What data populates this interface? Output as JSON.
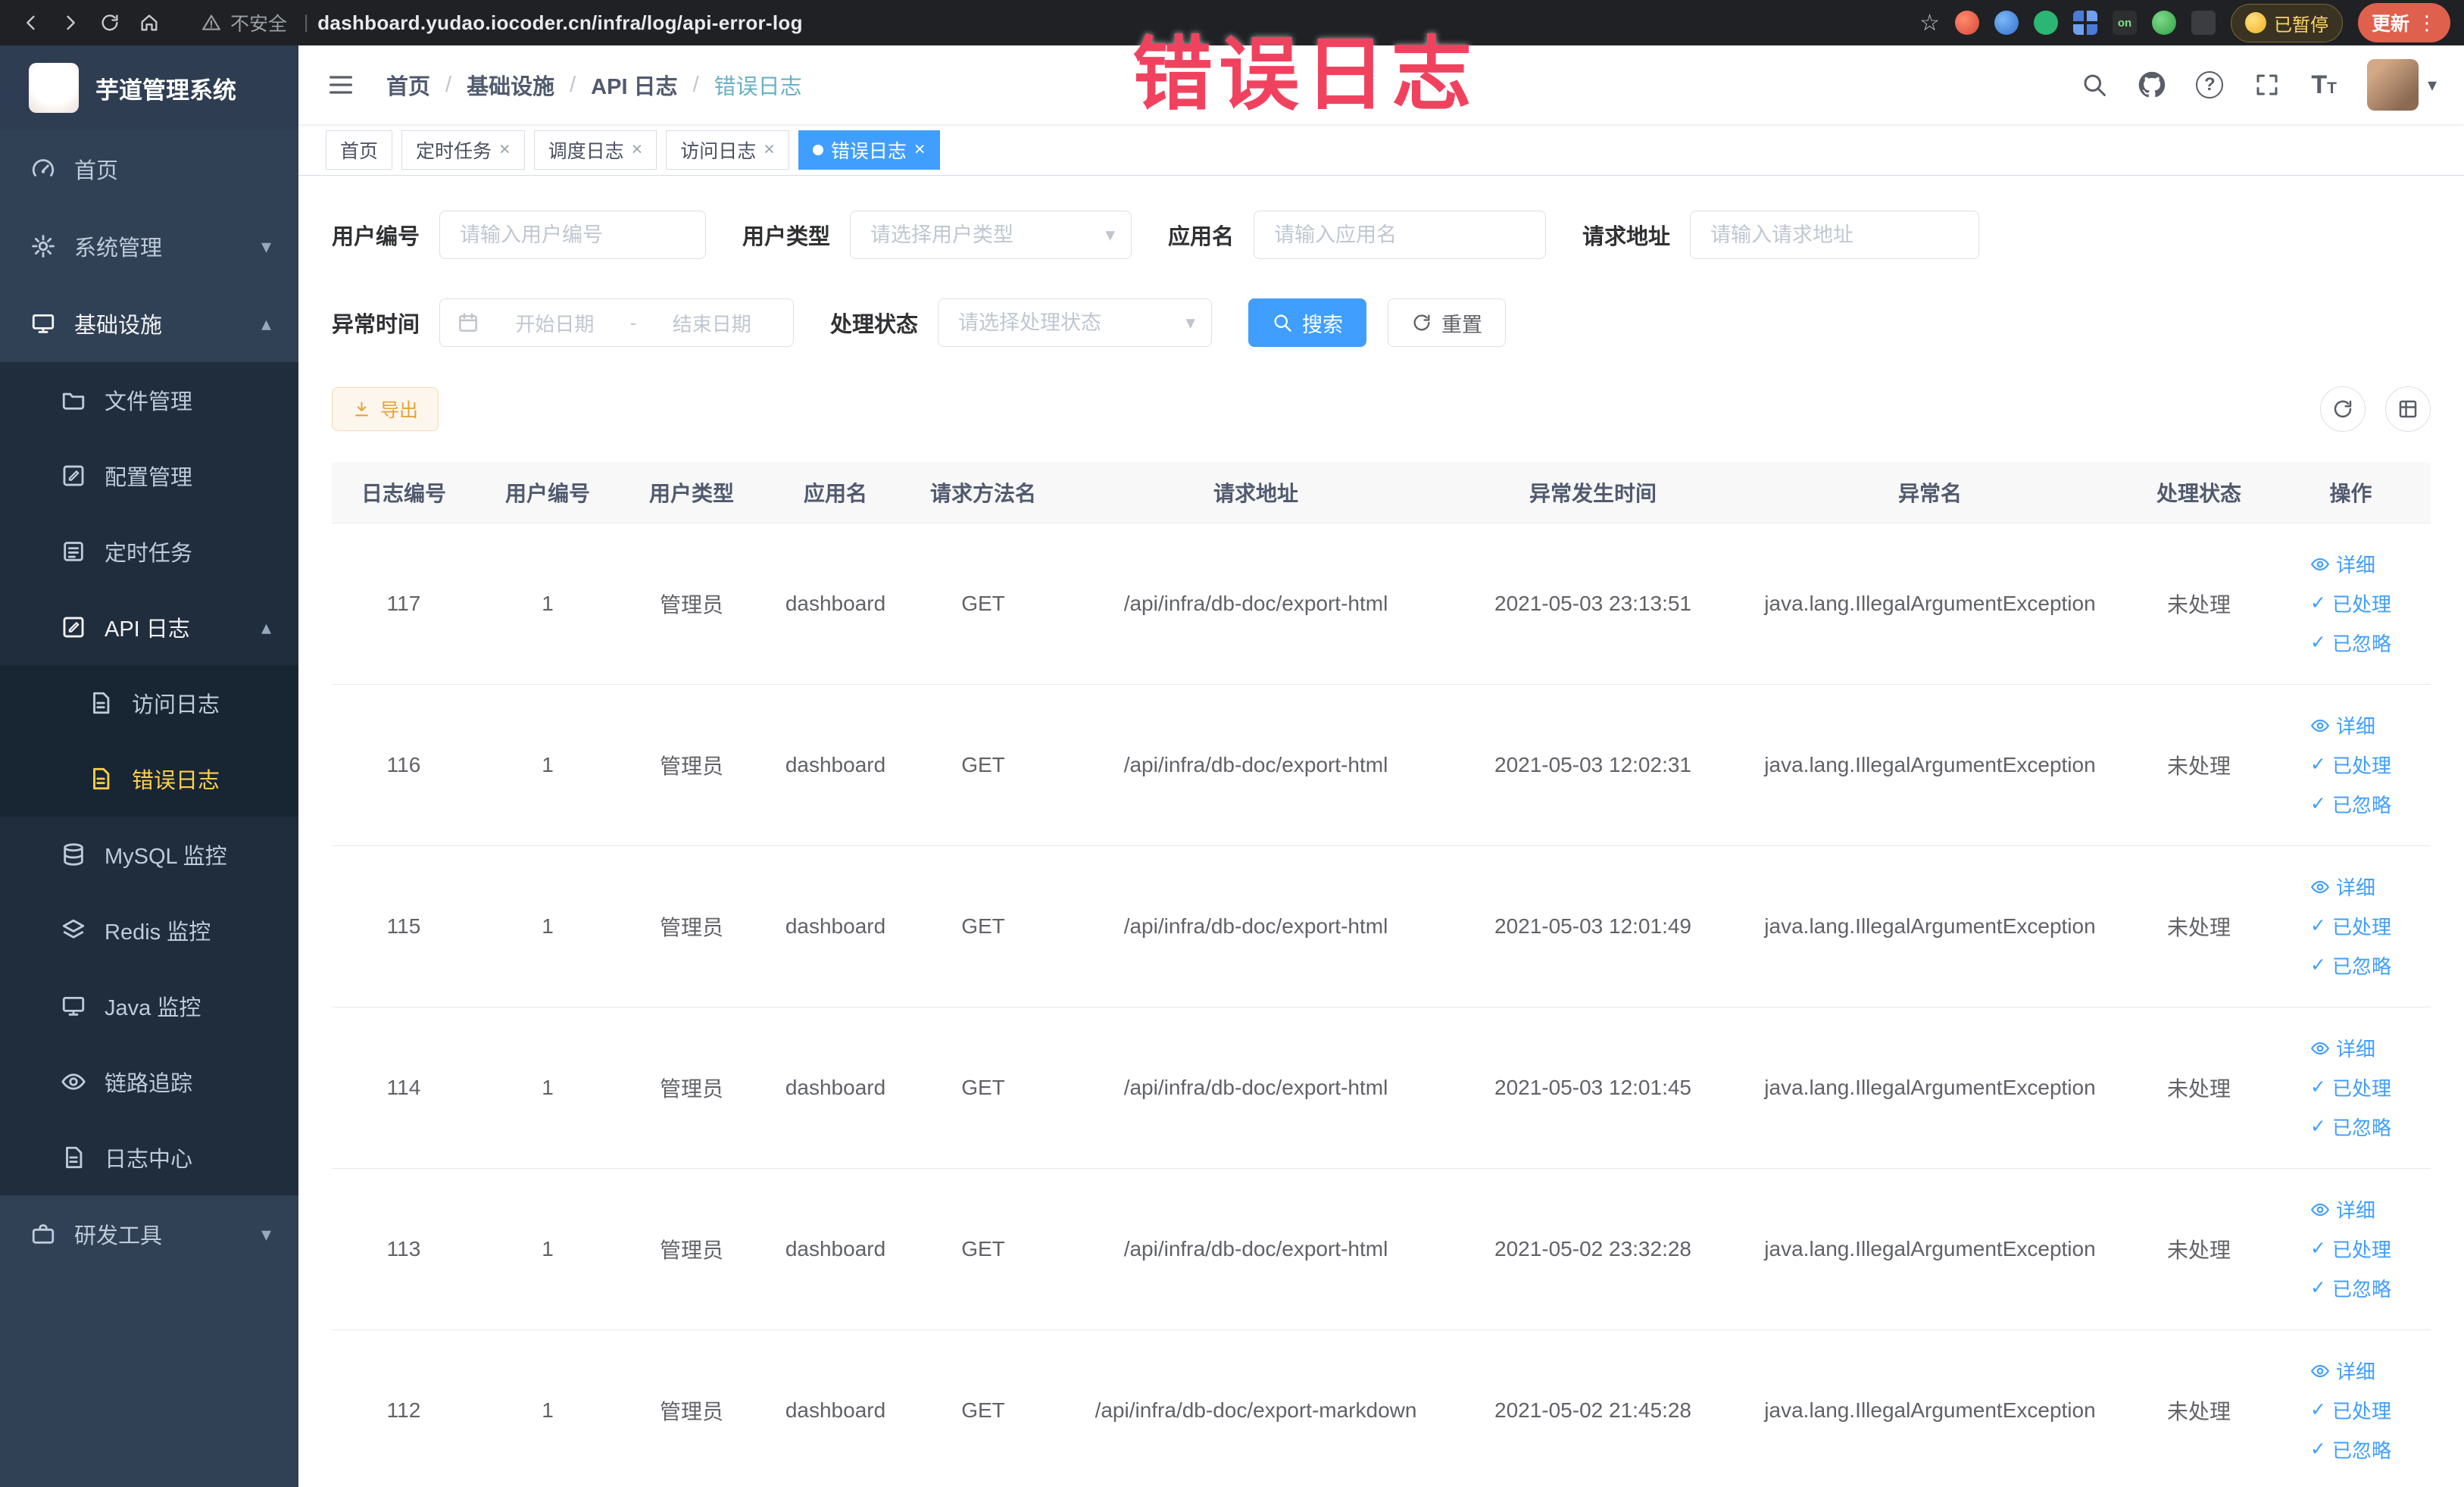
{
  "browser": {
    "security_label": "不安全",
    "url": "dashboard.yudao.iocoder.cn/infra/log/api-error-log",
    "extension_on_badge": "on",
    "paused_badge": "已暂停",
    "update_button": "更新"
  },
  "annotation": {
    "text": "错误日志"
  },
  "sidebar": {
    "title": "芋道管理系统",
    "items": [
      {
        "label": "首页"
      },
      {
        "label": "系统管理"
      },
      {
        "label": "基础设施"
      },
      {
        "label": "文件管理"
      },
      {
        "label": "配置管理"
      },
      {
        "label": "定时任务"
      },
      {
        "label": "API 日志"
      },
      {
        "label": "访问日志"
      },
      {
        "label": "错误日志"
      },
      {
        "label": "MySQL 监控"
      },
      {
        "label": "Redis 监控"
      },
      {
        "label": "Java 监控"
      },
      {
        "label": "链路追踪"
      },
      {
        "label": "日志中心"
      },
      {
        "label": "研发工具"
      }
    ]
  },
  "header": {
    "breadcrumb": [
      "首页",
      "基础设施",
      "API 日志",
      "错误日志"
    ],
    "breadcrumb_separator": "/"
  },
  "tabs": [
    {
      "label": "首页"
    },
    {
      "label": "定时任务"
    },
    {
      "label": "调度日志"
    },
    {
      "label": "访问日志"
    },
    {
      "label": "错误日志"
    }
  ],
  "filters": {
    "user_id_label": "用户编号",
    "user_id_placeholder": "请输入用户编号",
    "user_type_label": "用户类型",
    "user_type_placeholder": "请选择用户类型",
    "app_name_label": "应用名",
    "app_name_placeholder": "请输入应用名",
    "request_url_label": "请求地址",
    "request_url_placeholder": "请输入请求地址",
    "exception_time_label": "异常时间",
    "date_start_placeholder": "开始日期",
    "date_separator": "-",
    "date_end_placeholder": "结束日期",
    "process_status_label": "处理状态",
    "process_status_placeholder": "请选择处理状态",
    "search_button": "搜索",
    "reset_button": "重置"
  },
  "toolbar": {
    "export_button": "导出"
  },
  "table": {
    "columns": [
      "日志编号",
      "用户编号",
      "用户类型",
      "应用名",
      "请求方法名",
      "请求地址",
      "异常发生时间",
      "异常名",
      "处理状态",
      "操作"
    ],
    "actions": [
      "详细",
      "已处理",
      "已忽略"
    ],
    "rows": [
      {
        "log_id": "117",
        "user_id": "1",
        "user_type": "管理员",
        "app_name": "dashboard",
        "method": "GET",
        "request_url": "/api/infra/db-doc/export-html",
        "time": "2021-05-03 23:13:51",
        "exception": "java.lang.IllegalArgumentException",
        "status": "未处理"
      },
      {
        "log_id": "116",
        "user_id": "1",
        "user_type": "管理员",
        "app_name": "dashboard",
        "method": "GET",
        "request_url": "/api/infra/db-doc/export-html",
        "time": "2021-05-03 12:02:31",
        "exception": "java.lang.IllegalArgumentException",
        "status": "未处理"
      },
      {
        "log_id": "115",
        "user_id": "1",
        "user_type": "管理员",
        "app_name": "dashboard",
        "method": "GET",
        "request_url": "/api/infra/db-doc/export-html",
        "time": "2021-05-03 12:01:49",
        "exception": "java.lang.IllegalArgumentException",
        "status": "未处理"
      },
      {
        "log_id": "114",
        "user_id": "1",
        "user_type": "管理员",
        "app_name": "dashboard",
        "method": "GET",
        "request_url": "/api/infra/db-doc/export-html",
        "time": "2021-05-03 12:01:45",
        "exception": "java.lang.IllegalArgumentException",
        "status": "未处理"
      },
      {
        "log_id": "113",
        "user_id": "1",
        "user_type": "管理员",
        "app_name": "dashboard",
        "method": "GET",
        "request_url": "/api/infra/db-doc/export-html",
        "time": "2021-05-02 23:32:28",
        "exception": "java.lang.IllegalArgumentException",
        "status": "未处理"
      },
      {
        "log_id": "112",
        "user_id": "1",
        "user_type": "管理员",
        "app_name": "dashboard",
        "method": "GET",
        "request_url": "/api/infra/db-doc/export-markdown",
        "time": "2021-05-02 21:45:28",
        "exception": "java.lang.IllegalArgumentException",
        "status": "未处理"
      }
    ]
  },
  "icons": {
    "close": "×",
    "check": "✓",
    "caret_down": "▾",
    "caret_up": "▴",
    "star": "☆",
    "menu_dots": "⋮",
    "url_separator": "|",
    "question_mark": "?",
    "font_large": "T",
    "font_small": "T",
    "avatar_caret": "▾"
  },
  "colors": {
    "accent": "#409eff",
    "sidebar_bg": "#304156",
    "submenu_bg": "#1f2d3d",
    "active_menu_text": "#ffd04b",
    "annotation": "#f0425f",
    "warning": "#e6a23c",
    "browser_bar": "#202124",
    "update_pill": "#e0604e"
  }
}
